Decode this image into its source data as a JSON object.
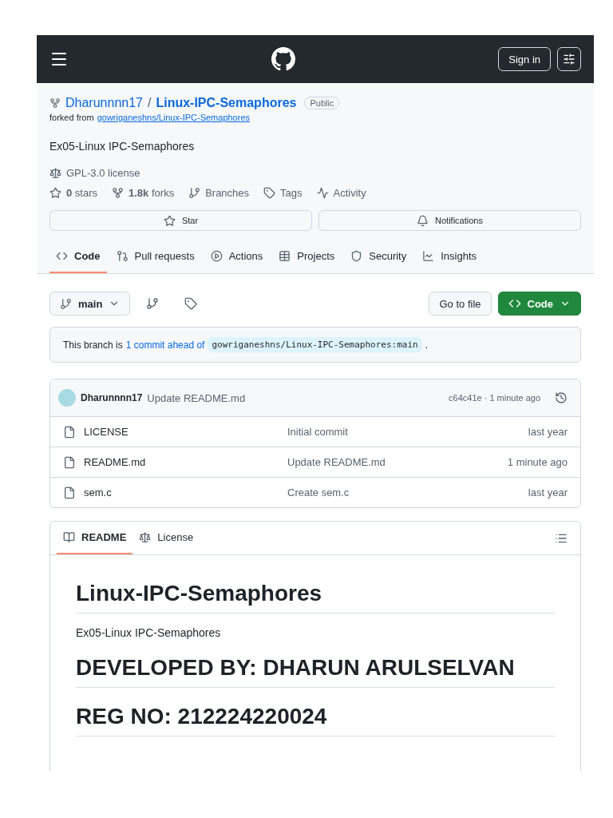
{
  "header": {
    "sign_in": "Sign in"
  },
  "repo": {
    "owner": "Dharunnnn17",
    "separator": "/",
    "name": "Linux-IPC-Semaphores",
    "visibility": "Public",
    "forked_label": "forked from",
    "forked_from": "gowriganeshns/Linux-IPC-Semaphores",
    "description": "Ex05-Linux IPC-Semaphores",
    "license": "GPL-3.0 license"
  },
  "stats": [
    {
      "kind": "stars",
      "text": "**0** stars"
    },
    {
      "kind": "forks",
      "text": "**1.8k** forks"
    },
    {
      "kind": "branches",
      "text": "Branches"
    },
    {
      "kind": "tags",
      "text": "Tags"
    },
    {
      "kind": "activity",
      "text": "Activity"
    }
  ],
  "actions": [
    {
      "kind": "star",
      "label": "Star"
    },
    {
      "kind": "bell",
      "label": "Notifications"
    }
  ],
  "tabs": [
    {
      "kind": "code",
      "label": "Code",
      "selected": true
    },
    {
      "kind": "pulls",
      "label": "Pull requests",
      "selected": false
    },
    {
      "kind": "actions",
      "label": "Actions",
      "selected": false
    },
    {
      "kind": "projects",
      "label": "Projects",
      "selected": false
    },
    {
      "kind": "security",
      "label": "Security",
      "selected": false
    },
    {
      "kind": "insights",
      "label": "Insights",
      "selected": false
    }
  ],
  "toolbar": {
    "branch": "main",
    "go_to_file": "Go to file",
    "code": "Code"
  },
  "ahead": {
    "prefix": "This branch is",
    "link": "1 commit ahead of",
    "ref": "gowriganeshns/Linux-IPC-Semaphores:main",
    "suffix": "."
  },
  "commit": {
    "author": "Dharunnnn17",
    "message": "Update README.md",
    "meta": "c64c41e · 1 minute ago"
  },
  "files": [
    {
      "name": "LICENSE",
      "message": "Initial commit",
      "time": "last year"
    },
    {
      "name": "README.md",
      "message": "Update README.md",
      "time": "1 minute ago"
    },
    {
      "name": "sem.c",
      "message": "Create sem.c",
      "time": "last year"
    }
  ],
  "readme_tabs": [
    {
      "kind": "book",
      "label": "README",
      "selected": true
    },
    {
      "kind": "scale",
      "label": "License",
      "selected": false
    }
  ],
  "readme": [
    {
      "kind": "h1",
      "text": "Linux-IPC-Semaphores"
    },
    {
      "kind": "p",
      "text": "Ex05-Linux IPC-Semaphores"
    },
    {
      "kind": "h2",
      "text": "DEVELOPED BY: DHARUN ARULSELVAN"
    },
    {
      "kind": "h2",
      "text": "REG NO: 212224220024"
    }
  ]
}
